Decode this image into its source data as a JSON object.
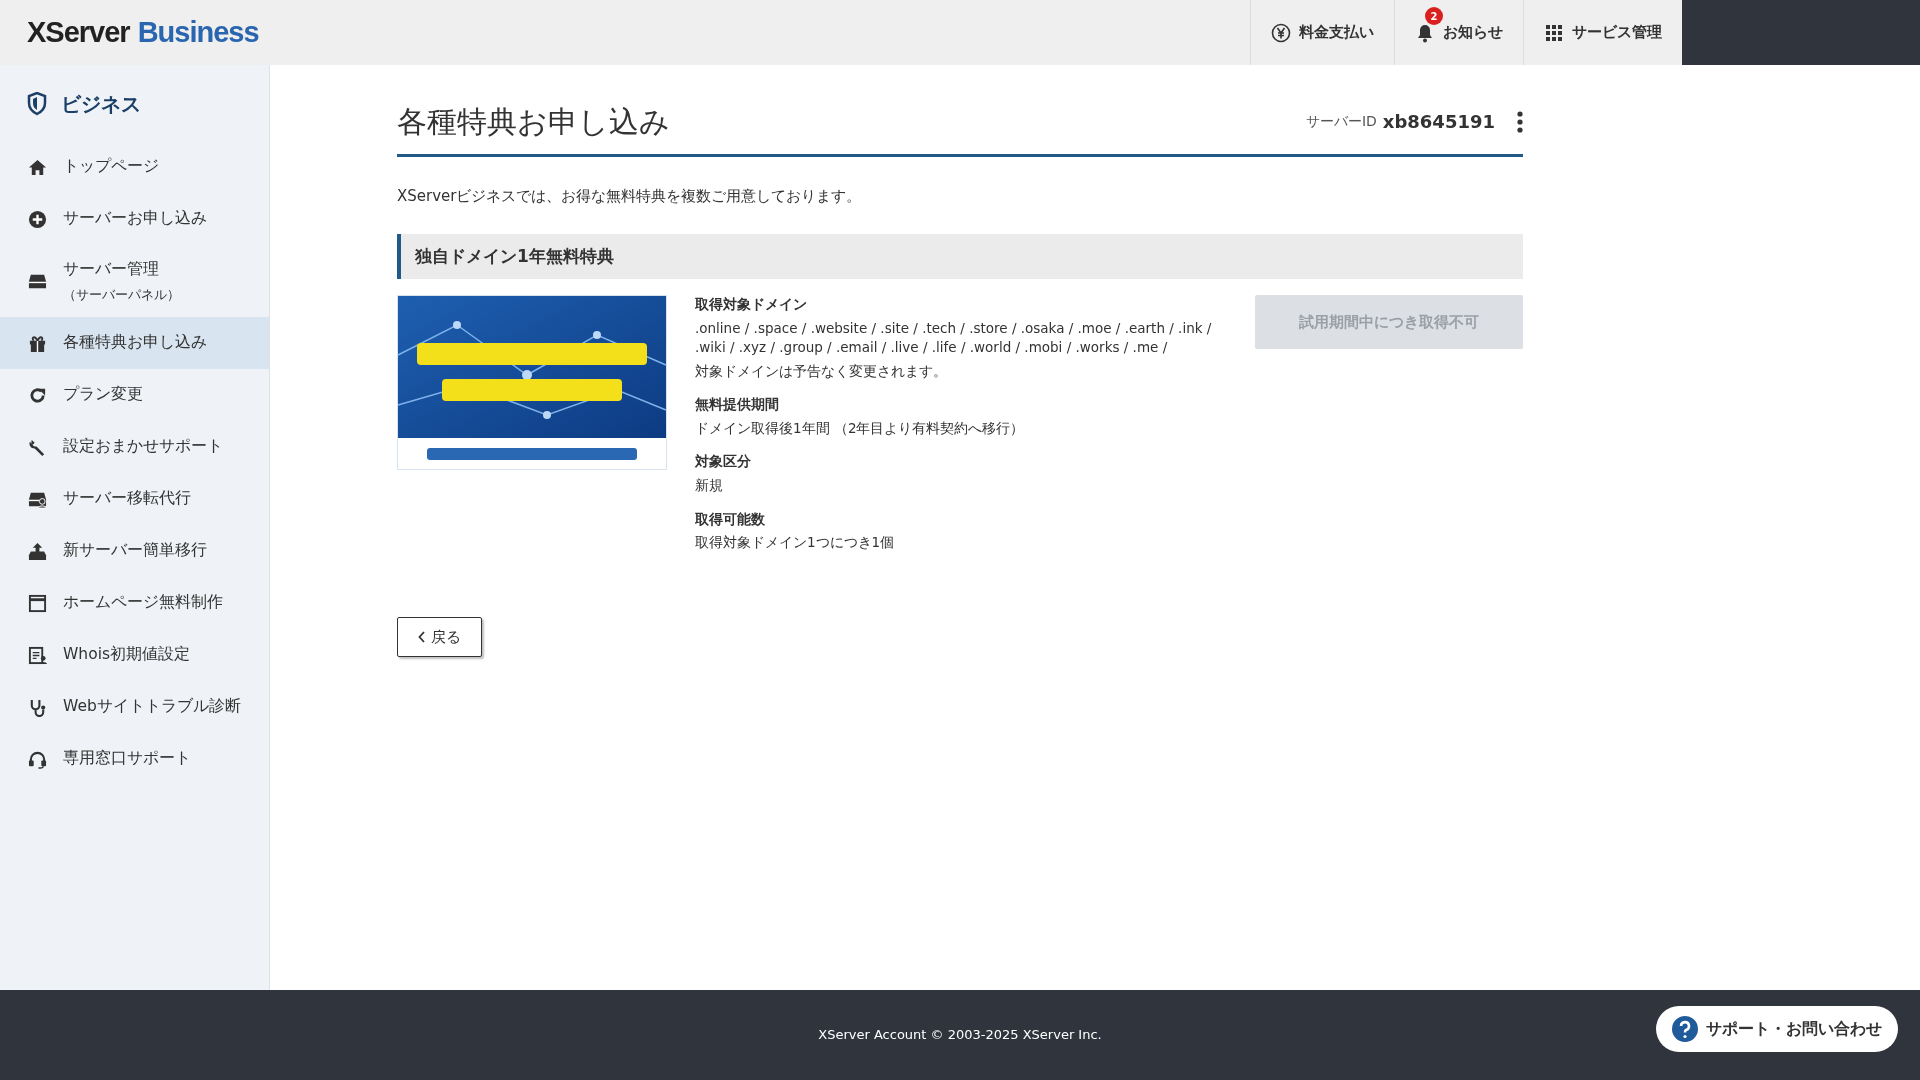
{
  "header": {
    "logo": {
      "brand": "XServer",
      "product": "Business"
    },
    "actions": [
      {
        "kind": "yen",
        "label": "料金支払い"
      },
      {
        "kind": "bell",
        "label": "お知らせ",
        "badge": "2"
      },
      {
        "kind": "grid",
        "label": "サービス管理"
      }
    ]
  },
  "sidebar": {
    "title": "ビジネス",
    "items": [
      {
        "kind": "home",
        "label": "トップページ",
        "selected": false
      },
      {
        "kind": "plus",
        "label": "サーバーお申し込み",
        "selected": false
      },
      {
        "kind": "server",
        "label": "サーバー管理",
        "sublabel": "（サーバーパネル）",
        "selected": false
      },
      {
        "kind": "gift",
        "label": "各種特典お申し込み",
        "selected": true
      },
      {
        "kind": "refresh",
        "label": "プラン変更",
        "selected": false
      },
      {
        "kind": "wrench",
        "label": "設定おまかせサポート",
        "selected": false
      },
      {
        "kind": "server-user",
        "label": "サーバー移転代行",
        "selected": false
      },
      {
        "kind": "upload",
        "label": "新サーバー簡単移行",
        "selected": false
      },
      {
        "kind": "window",
        "label": "ホームページ無料制作",
        "selected": false
      },
      {
        "kind": "document",
        "label": "Whois初期値設定",
        "selected": false
      },
      {
        "kind": "stethoscope",
        "label": "Webサイトトラブル診断",
        "selected": false
      },
      {
        "kind": "headset",
        "label": "専用窓口サポート",
        "selected": false
      }
    ]
  },
  "page": {
    "title": "各種特典お申し込み",
    "server_id_label": "サーバーID",
    "server_id": "xb8645191",
    "intro": "XServerビジネスでは、お得な無料特典を複数ご用意しております。",
    "section": {
      "title": "独自ドメイン1年無料特典",
      "details": [
        {
          "label": "取得対象ドメイン",
          "lines": [
            ".online / .space / .website / .site / .tech / .store / .osaka / .moe / .earth / .ink / .wiki / .xyz / .group / .email / .live / .life / .world / .mobi / .works / .me /",
            "対象ドメインは予告なく変更されます。"
          ]
        },
        {
          "label": "無料提供期間",
          "lines": [
            "ドメイン取得後1年間 （2年目より有料契約へ移行）"
          ]
        },
        {
          "label": "対象区分",
          "lines": [
            "新規"
          ]
        },
        {
          "label": "取得可能数",
          "lines": [
            "取得対象ドメイン1つにつき1個"
          ]
        }
      ],
      "button": {
        "label": "試用期間中につき取得不可",
        "disabled": true
      }
    },
    "back": "戻る"
  },
  "footer": {
    "copyright": "XServer Account © 2003-2025 XServer Inc.",
    "support": "サポート・お問い合わせ"
  }
}
